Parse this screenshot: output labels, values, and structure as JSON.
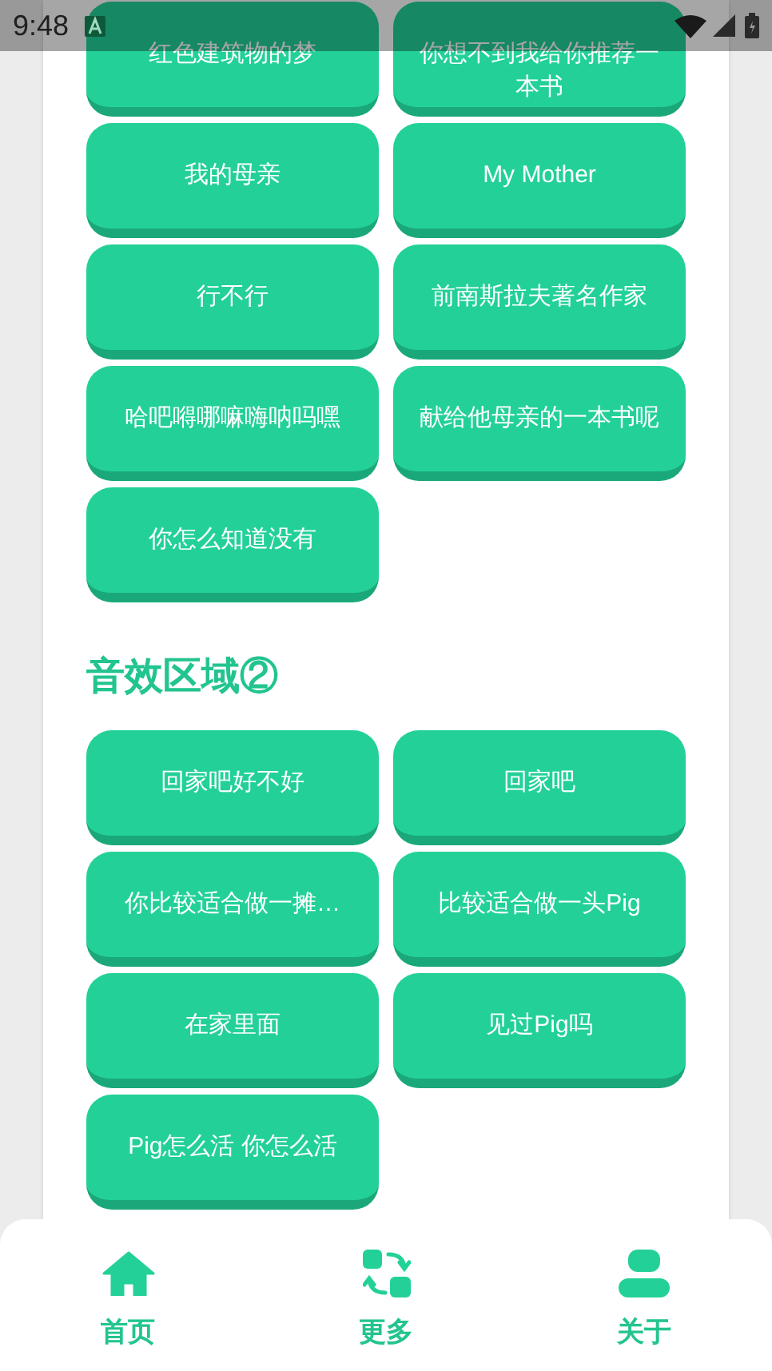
{
  "status_bar": {
    "time": "9:48"
  },
  "groups": [
    {
      "buttons": [
        "红色建筑物的梦",
        "你想不到我给你推荐一本书",
        "我的母亲",
        "My Mother",
        "行不行",
        "前南斯拉夫著名作家",
        "哈吧嘚哪嘛嗨呐吗嘿",
        "献给他母亲的一本书呢",
        "你怎么知道没有"
      ]
    },
    {
      "title": "音效区域②",
      "buttons": [
        "回家吧好不好",
        "回家吧",
        "你比较适合做一摊…",
        "比较适合做一头Pig",
        "在家里面",
        "见过Pig吗",
        "Pig怎么活 你怎么活"
      ]
    }
  ],
  "bottom_nav": [
    {
      "kind": "home",
      "label": "首页"
    },
    {
      "kind": "more",
      "label": "更多"
    },
    {
      "kind": "about",
      "label": "关于"
    }
  ]
}
